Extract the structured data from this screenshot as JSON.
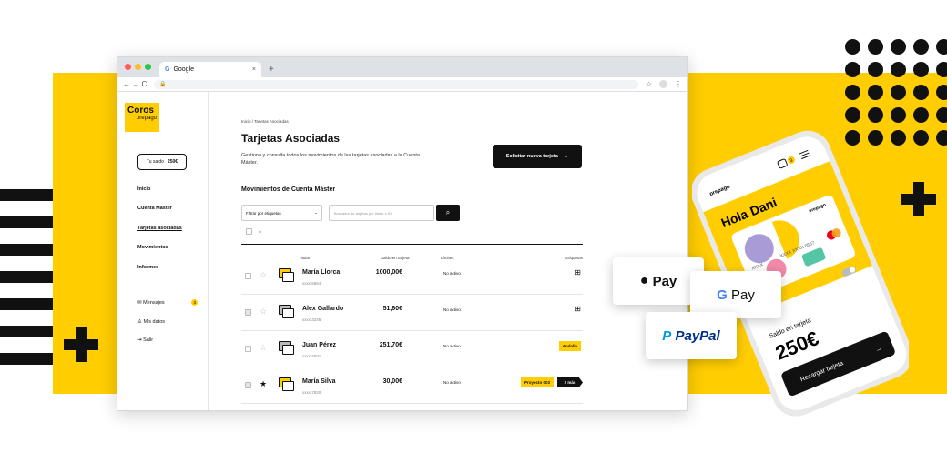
{
  "browser": {
    "tab_title": "Google",
    "tab_g": "G",
    "tab_close": "×",
    "new_tab": "+",
    "nav_icons": "←  →  C"
  },
  "sidebar": {
    "logo": "Coros",
    "logo_sub": "prepago",
    "balance_label": "Tu saldo",
    "balance_value": "250€",
    "items": [
      "Inicio",
      "Cuenta Máster",
      "Tarjetas asociadas",
      "Movimientos",
      "Informes"
    ],
    "footer": [
      {
        "label": "Mensajes",
        "badge": "3"
      },
      {
        "label": "Mis datos"
      },
      {
        "label": "Salir"
      }
    ]
  },
  "main": {
    "breadcrumb": "Inicio / Tarjetas Asociadas",
    "title": "Tarjetas Asociadas",
    "description": "Gestiona y consulta todos los movimientos de las tarjetas asociadas a la Cuenta Máster.",
    "cta": "Solicitar nueva tarjeta",
    "section": "Movimientos de Cuenta Máster",
    "filter_placeholder": "Filtrar por etiquetas",
    "search_placeholder": "Buscador de tarjetas por titular o ID",
    "headers": [
      "Titular",
      "Saldo en tarjeta",
      "Límites",
      "Etiquetas"
    ],
    "rows": [
      {
        "name": "María Llorca",
        "num": "xxxx 5654",
        "amount": "1000,00€",
        "limit": "No activo",
        "starred": false,
        "grey": false
      },
      {
        "name": "Alex Gallardo",
        "num": "xxxx 3246",
        "amount": "51,60€",
        "limit": "No activo",
        "starred": false,
        "grey": true
      },
      {
        "name": "Juan Pérez",
        "num": "xxxx 2501",
        "amount": "251,70€",
        "limit": "No activo",
        "starred": false,
        "grey": true,
        "tag": "Andalia"
      },
      {
        "name": "María Silva",
        "num": "xxxx 7820",
        "amount": "30,00€",
        "limit": "No activo",
        "starred": true,
        "grey": false,
        "tag": "Proyecto 003",
        "more": "2 más"
      }
    ]
  },
  "phone": {
    "brand": "prepago",
    "greeting": "Hola Dani",
    "card_brand": "prepago",
    "card_number": "XXXX  XXXX  0567",
    "card_masked": "XXXX",
    "badge": "3",
    "balance_label": "Saldo en tarjeta",
    "balance": "250€",
    "cta": "Recargar tarjeta"
  },
  "payments": {
    "apple": "Pay",
    "google": "Pay",
    "paypal": "PayPal"
  },
  "colors": {
    "accent": "#ffcd00",
    "dark": "#111111"
  }
}
